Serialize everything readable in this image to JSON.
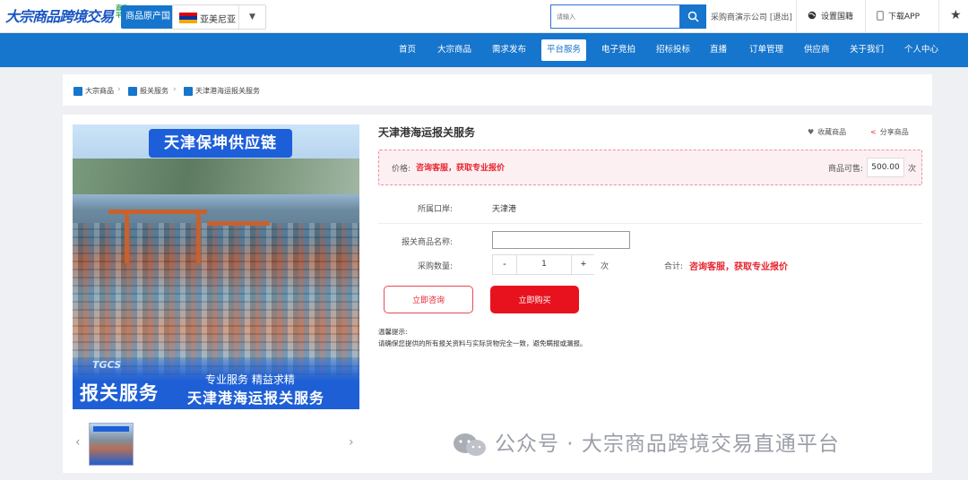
{
  "header": {
    "logo_text": "大宗商品跨境交易",
    "logo_sub": "直通平台",
    "origin_button": "商品原产国",
    "country": "亚美尼亚",
    "search_placeholder": "请输入",
    "company": "采购商演示公司 [退出]",
    "set_country": "设置国籍",
    "download_app": "下载APP",
    "accent_color": "#1675cc"
  },
  "nav": {
    "items": [
      "首页",
      "大宗商品",
      "需求发布",
      "平台服务",
      "电子竞拍",
      "招标投标",
      "直播",
      "订单管理",
      "供应商",
      "关于我们",
      "个人中心"
    ],
    "active": "平台服务"
  },
  "breadcrumb": [
    "大宗商品",
    "报关服务",
    "天津港海运报关服务"
  ],
  "gallery": {
    "banner_title": "天津保坤供应链",
    "logo": "TGCS",
    "service_left": "报关服务",
    "service_sub": "专业服务    精益求精",
    "service_big": "天津港海运报关服务"
  },
  "product": {
    "title": "天津港海运报关服务",
    "favorite": "收藏商品",
    "share": "分享商品",
    "price_label": "价格:",
    "price_value": "咨询客服，获取专业报价",
    "supply_label": "商品可售:",
    "supply_value": "500.00",
    "supply_unit": "次",
    "port_label": "所属口岸:",
    "port_value": "天津港",
    "name_label": "报关商品名称:",
    "qty_label": "采购数量:",
    "qty_minus": "-",
    "qty_value": "1",
    "qty_plus": "+",
    "qty_unit": "次",
    "total_label": "合计:",
    "total_value": "咨询客服，获取专业报价",
    "consult_button": "立即咨询",
    "buy_button": "立即购买",
    "tip_title": "温馨提示:",
    "tip_body": "请确保您提供的所有报关资料与实际货物完全一致，避免瞒报或漏报。"
  },
  "watermark": "公众号 · 大宗商品跨境交易直通平台"
}
